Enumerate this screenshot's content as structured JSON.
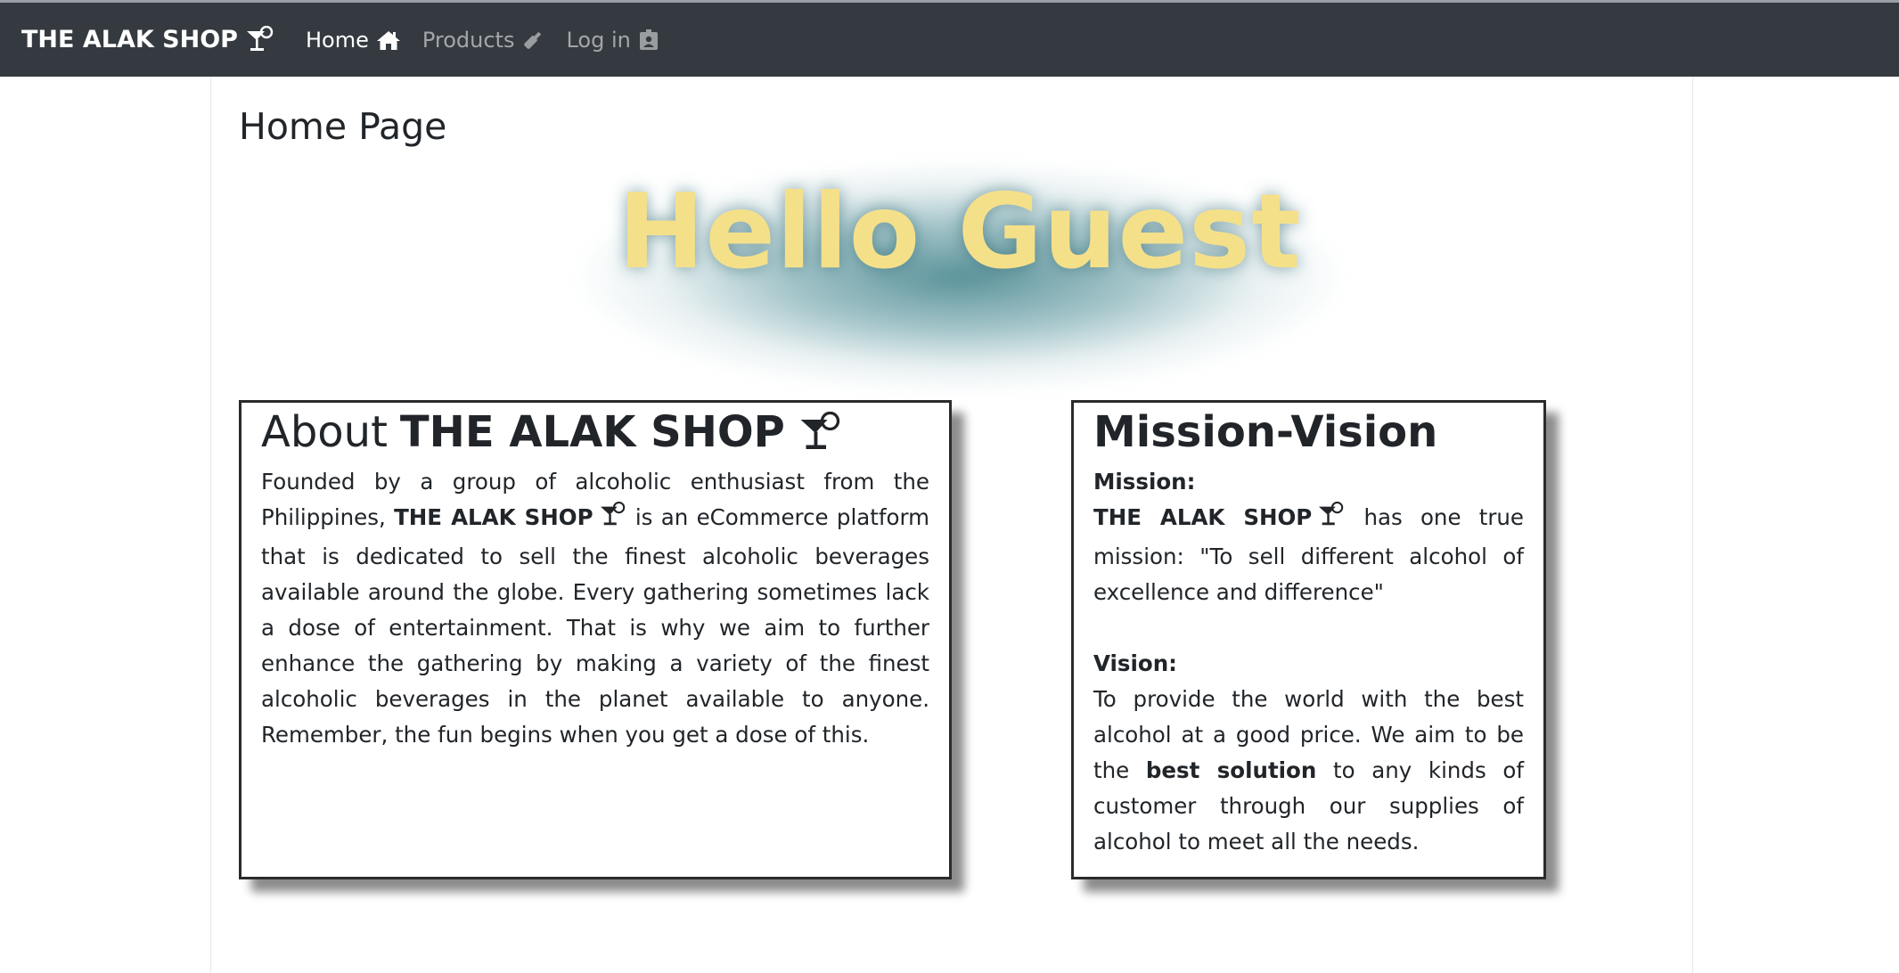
{
  "navbar": {
    "brand": "THE ALAK SHOP",
    "brand_icon": "cocktail-icon",
    "items": [
      {
        "label": "Home",
        "icon": "home-icon",
        "active": true
      },
      {
        "label": "Products",
        "icon": "wine-bottle-icon",
        "active": false
      },
      {
        "label": "Log in",
        "icon": "id-badge-icon",
        "active": false
      }
    ]
  },
  "main": {
    "page_title": "Home Page",
    "greeting": "Hello Guest",
    "colors": {
      "greeting_text": "#f5e08a",
      "greeting_glow": "#3e8089",
      "navbar_bg": "#343a40"
    }
  },
  "about": {
    "heading_prefix": "About",
    "heading_brand": "THE ALAK SHOP",
    "text_before": "Founded by a group of alcoholic enthusiast from the Philippines, ",
    "brand_inline": "THE ALAK SHOP",
    "text_after": " is an eCommerce platform that is dedicated to sell the finest alcoholic beverages available around the globe. Every gathering sometimes lack a dose of entertainment. That is why we aim to further enhance the gathering by making a variety of the finest alcoholic beverages in the planet available to anyone. Remember, the fun begins when you get a dose of this."
  },
  "mission_vision": {
    "heading": "Mission-Vision",
    "mission_label": "Mission:",
    "mission_brand": "THE ALAK SHOP",
    "mission_text": " has one true mission: \"To sell different alcohol of excellence and difference\"",
    "vision_label": "Vision:",
    "vision_text_before": "To provide the world with the best alcohol at a good price. We aim to be the ",
    "vision_bold": "best solution",
    "vision_text_after": " to any kinds of customer through our supplies of alcohol to meet all the needs."
  }
}
